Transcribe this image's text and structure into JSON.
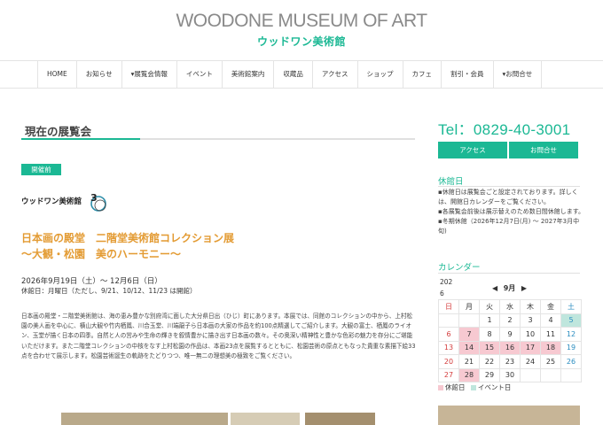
{
  "header": {
    "title": "WOODONE MUSEUM OF ART",
    "subtitle": "ウッドワン美術館"
  },
  "nav": [
    {
      "label": "HOME"
    },
    {
      "label": "お知らせ"
    },
    {
      "label": "▾展覧会情報"
    },
    {
      "label": "イベント"
    },
    {
      "label": "美術館案内"
    },
    {
      "label": "収蔵品"
    },
    {
      "label": "アクセス"
    },
    {
      "label": "ショップ"
    },
    {
      "label": "カフェ"
    },
    {
      "label": "割引・会員"
    },
    {
      "label": "▾お問合せ"
    }
  ],
  "main": {
    "page_title": "現在の展覧会",
    "badge": "開催前",
    "logo_text": "ウッドワン美術館",
    "logo_mark": "3",
    "exhibition_title_1": "日本画の殿堂　二階堂美術館コレクション展",
    "exhibition_title_2": "〜大観・松園　美のハーモニー〜",
    "date": "2026年9月19日（土）〜 12月6日（日）",
    "closed": "休館日：月曜日（ただし、9/21、10/12、11/23 は開館）",
    "description": "日本画の殿堂・二階堂美術館は、海の恵み豊かな別府湾に面した大分県日出（ひじ）町にあります。本展では、同館のコレクションの中から、上村松園の美人画を中心に、横山大観や竹内栖鳳、川合玉堂、川端龍子ら日本画の大家の作品を約100点精選してご紹介します。大観の富士、栖鳳のライオン、玉堂が描く日本の四季。自然と人の営みや生命の輝きを叙情豊かに描き出す日本画の数々。その奥深い精神性と豊かな色彩の魅力を存分にご堪能いただけます。また二階堂コレクションの中核をなす上村松園の作品は、本画23点を展覧するとともに、松園芸術の原点ともなった貴重な素描下絵33点を合わせて展示します。松園芸術誕生の軌跡をたどりつつ、唯一無二の理想美の極致をご覧ください。"
  },
  "sidebar": {
    "tel": "Tel：0829-40-3001",
    "access_button": "アクセス",
    "contact_button": "お問合せ",
    "closed_heading": "休館日",
    "notes": [
      "▪休館日は展覧会ごと設定されております。詳しくは、開館日カレンダーをご覧ください。",
      "▪各展覧会前後は展示替えのため数日間休館します。",
      "▪冬期休館（2026年12月7日(月) 〜 2027年3月中旬)"
    ],
    "calendar_heading": "カレンダー",
    "calendar": {
      "year": "202",
      "month_digit": "6",
      "prev": "◀",
      "month_label": "9月",
      "next": "▶",
      "weekdays": [
        "日",
        "月",
        "火",
        "水",
        "木",
        "金",
        "土"
      ],
      "weeks": [
        [
          {
            "d": "",
            "s": ""
          },
          {
            "d": "",
            "s": ""
          },
          {
            "d": "1",
            "s": ""
          },
          {
            "d": "2",
            "s": ""
          },
          {
            "d": "3",
            "s": ""
          },
          {
            "d": "4",
            "s": ""
          },
          {
            "d": "5",
            "s": "event"
          }
        ],
        [
          {
            "d": "6",
            "s": ""
          },
          {
            "d": "7",
            "s": "closed"
          },
          {
            "d": "8",
            "s": ""
          },
          {
            "d": "9",
            "s": ""
          },
          {
            "d": "10",
            "s": ""
          },
          {
            "d": "11",
            "s": ""
          },
          {
            "d": "12",
            "s": ""
          }
        ],
        [
          {
            "d": "13",
            "s": ""
          },
          {
            "d": "14",
            "s": "closed"
          },
          {
            "d": "15",
            "s": "closed"
          },
          {
            "d": "16",
            "s": "closed"
          },
          {
            "d": "17",
            "s": "closed"
          },
          {
            "d": "18",
            "s": "closed"
          },
          {
            "d": "19",
            "s": ""
          }
        ],
        [
          {
            "d": "20",
            "s": ""
          },
          {
            "d": "21",
            "s": ""
          },
          {
            "d": "22",
            "s": ""
          },
          {
            "d": "23",
            "s": ""
          },
          {
            "d": "24",
            "s": ""
          },
          {
            "d": "25",
            "s": ""
          },
          {
            "d": "26",
            "s": ""
          }
        ],
        [
          {
            "d": "27",
            "s": ""
          },
          {
            "d": "28",
            "s": "closed"
          },
          {
            "d": "29",
            "s": ""
          },
          {
            "d": "30",
            "s": ""
          },
          {
            "d": "",
            "s": ""
          },
          {
            "d": "",
            "s": ""
          },
          {
            "d": "",
            "s": ""
          }
        ]
      ],
      "legend_closed": "休館日",
      "legend_event": "イベント日"
    }
  },
  "colors": {
    "accent": "#1bb894",
    "title_orange": "#e39b33",
    "closed_pink": "#f7c9d1",
    "event_green": "#bfe6dd"
  }
}
